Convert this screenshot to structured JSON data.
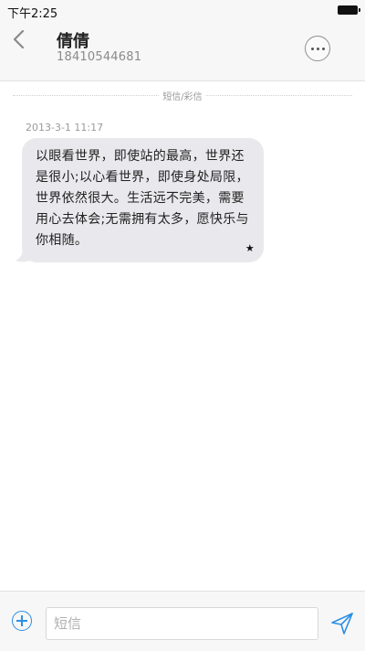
{
  "status_bar": {
    "time": "下午2:25"
  },
  "header": {
    "contact_name": "倩倩",
    "contact_number": "18410544681",
    "back_icon": "chevron-left-icon",
    "more_icon": "ellipsis-icon"
  },
  "conversation": {
    "type_label": "短信/彩信",
    "messages": [
      {
        "timestamp": "2013-3-1 11:17",
        "text": "以眼看世界，即使站的最高，世界还是很小;以心看世界，即使身处局限，世界依然很大。生活远不完美，需要用心去体会;无需拥有太多，愿快乐与你相随。",
        "star": "★"
      }
    ]
  },
  "compose": {
    "placeholder": "短信",
    "value": "",
    "add_icon": "plus-circle-icon",
    "send_icon": "send-icon"
  },
  "colors": {
    "accent": "#2b8fe6",
    "bubble_background": "#e9e9ed",
    "bar_background": "#f7f7f7"
  }
}
